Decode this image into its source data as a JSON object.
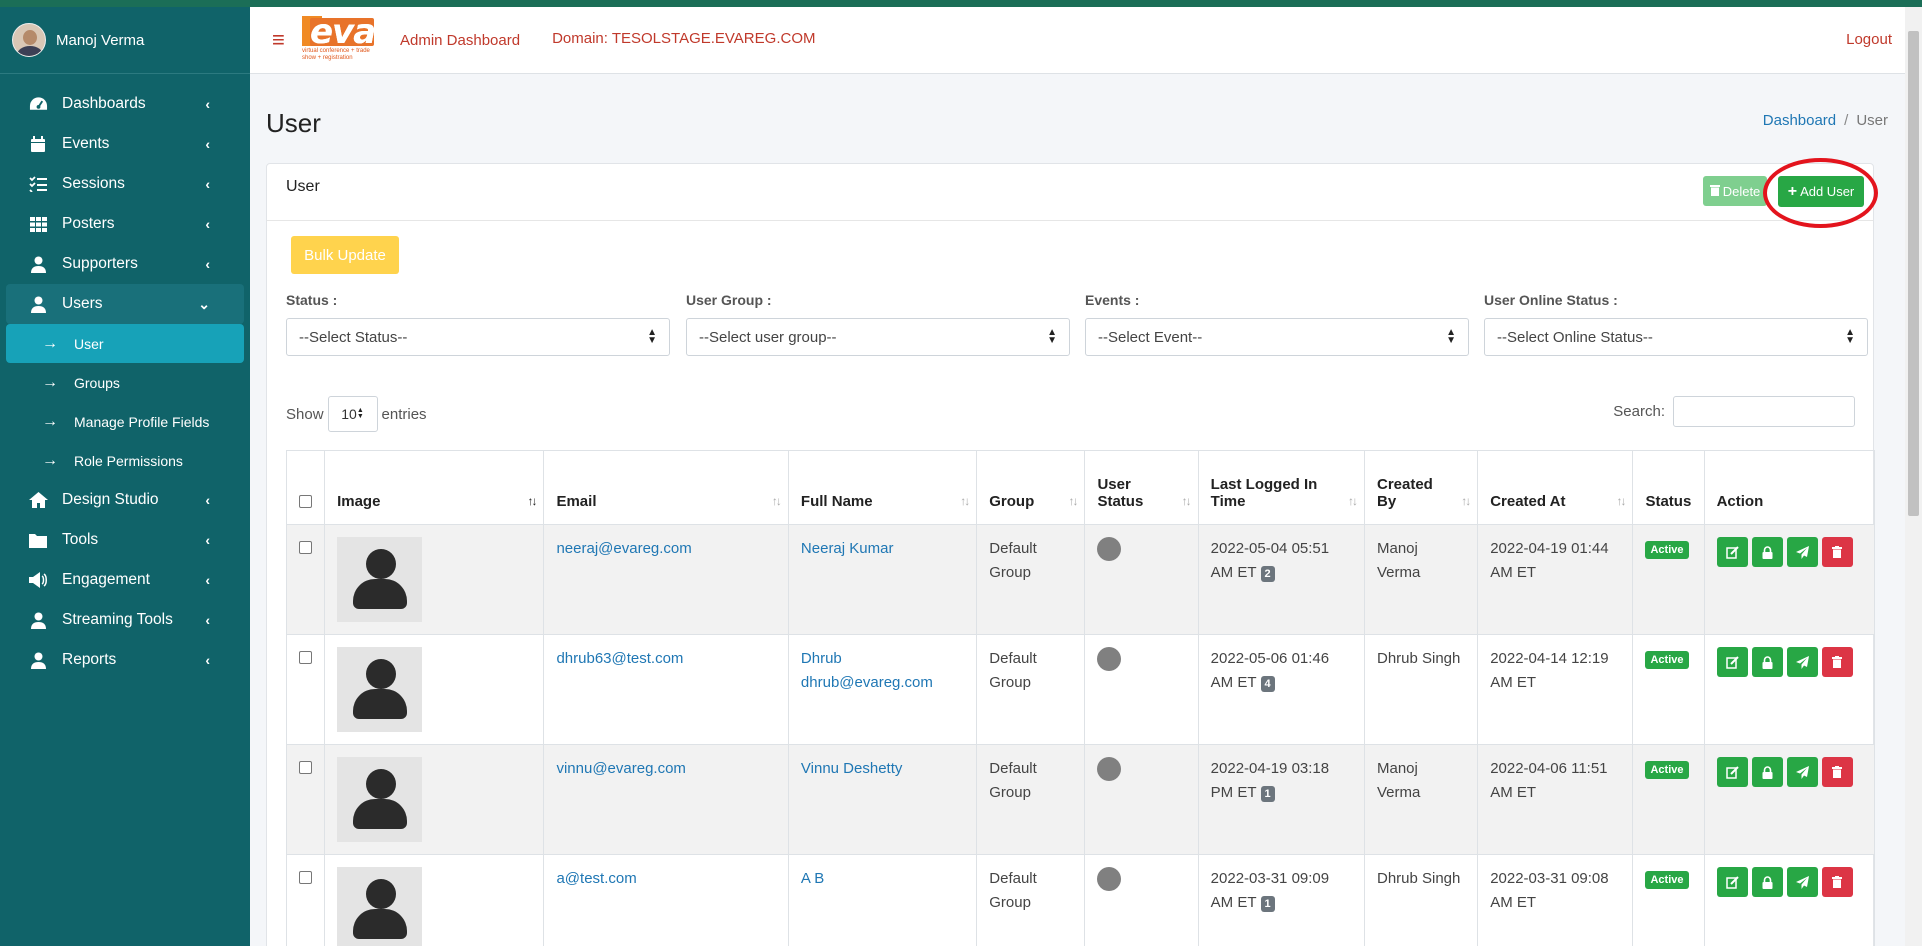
{
  "sidebar": {
    "user_name": "Manoj Verma",
    "items": [
      {
        "label": "Dashboards",
        "icon": "dashboard-icon"
      },
      {
        "label": "Events",
        "icon": "calendar-icon"
      },
      {
        "label": "Sessions",
        "icon": "list-check-icon"
      },
      {
        "label": "Posters",
        "icon": "grid-icon"
      },
      {
        "label": "Supporters",
        "icon": "user-icon"
      },
      {
        "label": "Users",
        "icon": "user-icon"
      },
      {
        "label": "Design Studio",
        "icon": "home-icon"
      },
      {
        "label": "Tools",
        "icon": "folder-icon"
      },
      {
        "label": "Engagement",
        "icon": "megaphone-icon"
      },
      {
        "label": "Streaming Tools",
        "icon": "user-icon"
      },
      {
        "label": "Reports",
        "icon": "user-icon"
      }
    ],
    "sub_items": [
      {
        "label": "User"
      },
      {
        "label": "Groups"
      },
      {
        "label": "Manage Profile Fields"
      },
      {
        "label": "Role Permissions"
      }
    ]
  },
  "header": {
    "logo_text": "eva",
    "logo_tagline": "virtual conference + trade show + registration",
    "admin_dashboard": "Admin Dashboard",
    "domain": "Domain: TESOLSTAGE.EVAREG.COM",
    "logout": "Logout"
  },
  "page": {
    "title": "User",
    "breadcrumb": {
      "home": "Dashboard",
      "separator": "/",
      "current": "User"
    }
  },
  "card": {
    "title": "User",
    "delete_label": "Delete",
    "add_label": "Add User",
    "bulk_label": "Bulk Update"
  },
  "filters": [
    {
      "label": "Status :",
      "value": "--Select Status--"
    },
    {
      "label": "User Group :",
      "value": "--Select user group--"
    },
    {
      "label": "Events :",
      "value": "--Select Event--"
    },
    {
      "label": "User Online Status :",
      "value": "--Select Online Status--"
    }
  ],
  "table_controls": {
    "show": "Show",
    "entries_value": "10",
    "entries": "entries",
    "search": "Search:"
  },
  "table": {
    "columns": [
      "Image",
      "Email",
      "Full Name",
      "Group",
      "User Status",
      "Last Logged In Time",
      "Created By",
      "Created At",
      "Status",
      "Action"
    ],
    "rows": [
      {
        "email": "neeraj@evareg.com",
        "name": "Neeraj Kumar",
        "group": "Default Group",
        "last_login": "2022-05-04 05:51 AM ET",
        "login_count": "2",
        "created_by": "Manoj Verma",
        "created_at": "2022-04-19 01:44 AM ET",
        "status": "Active"
      },
      {
        "email": "dhrub63@test.com",
        "name": "Dhrub dhrub@evareg.com",
        "group": "Default Group",
        "last_login": "2022-05-06 01:46 AM ET",
        "login_count": "4",
        "created_by": "Dhrub Singh",
        "created_at": "2022-04-14 12:19 AM ET",
        "status": "Active"
      },
      {
        "email": "vinnu@evareg.com",
        "name": "Vinnu Deshetty",
        "group": "Default Group",
        "last_login": "2022-04-19 03:18 PM ET",
        "login_count": "1",
        "created_by": "Manoj Verma",
        "created_at": "2022-04-06 11:51 AM ET",
        "status": "Active"
      },
      {
        "email": "a@test.com",
        "name": "A B",
        "group": "Default Group",
        "last_login": "2022-03-31 09:09 AM ET",
        "login_count": "1",
        "created_by": "Dhrub Singh",
        "created_at": "2022-03-31 09:08 AM ET",
        "status": "Active"
      }
    ]
  },
  "colors": {
    "sidebar": "#106369",
    "active_sub": "#17a2b8",
    "success": "#28a745",
    "danger": "#dc3545",
    "warning": "#ffd34d",
    "accent_red": "#c0392b"
  }
}
